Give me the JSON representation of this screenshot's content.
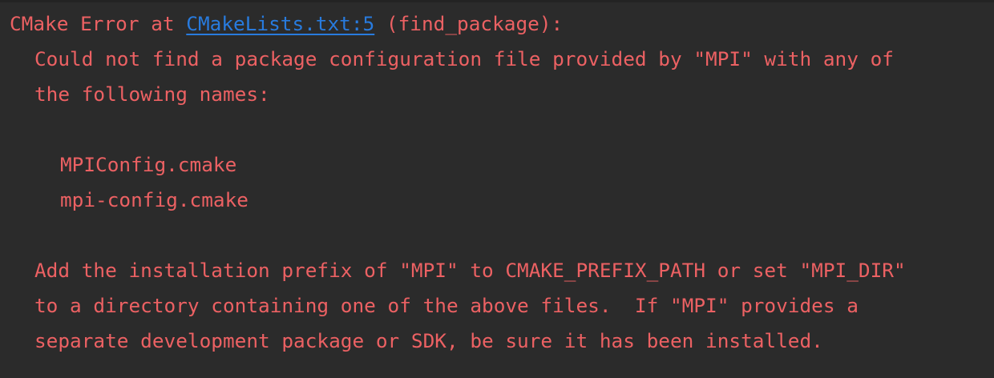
{
  "console": {
    "header": {
      "prefix": "CMake Error at ",
      "link": "CMakeLists.txt:5",
      "suffix": " (find_package):"
    },
    "lines": [
      "Could not find a package configuration file provided by \"MPI\" with any of",
      "the following names:",
      "",
      "MPIConfig.cmake",
      "mpi-config.cmake",
      "",
      "Add the installation prefix of \"MPI\" to CMAKE_PREFIX_PATH or set \"MPI_DIR\"",
      "to a directory containing one of the above files.  If \"MPI\" provides a",
      "separate development package or SDK, be sure it has been installed."
    ]
  },
  "colors": {
    "background": "#2b2b2b",
    "error_text": "#ec6163",
    "link": "#287bde"
  }
}
